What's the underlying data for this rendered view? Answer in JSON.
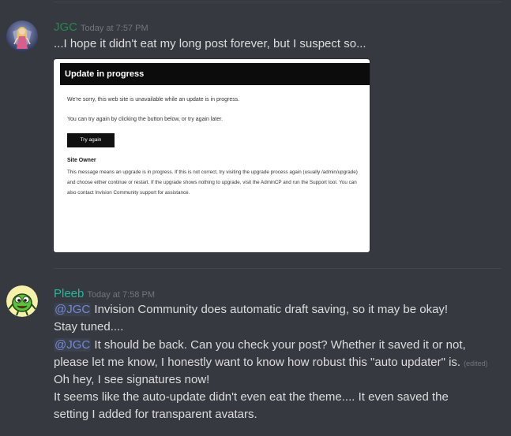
{
  "messages": [
    {
      "username": "JGC",
      "username_color": "#1f8b4c",
      "timestamp": "Today at 7:57 PM",
      "avatar_icon": "fairy-avatar-icon",
      "text": "...I hope it didn't eat my long post forever, but I suspect so...",
      "embed": {
        "title": "Update in progress",
        "line1": "We're sorry, this web site is unavailable while an update is in progress.",
        "line2": "You can try again by clicking the button below, or try again later.",
        "button_label": "Try again",
        "owner_title": "Site Owner",
        "owner_text": "This message means an upgrade is in progress. If this is not correct, try visiting the upgrade process again (usually /admin/upgrade) and choose either continue or restart. If the upgrade shows nothing to upgrade, visit the AdminCP and run the Support tool. You can also contact Invision Community support for assistance."
      }
    },
    {
      "username": "Pleeb",
      "username_color": "#1abc9c",
      "timestamp": "Today at 7:58 PM",
      "avatar_icon": "green-creature-avatar-icon",
      "lines": [
        {
          "mention": "@JGC",
          "text": " Invision Community does automatic draft saving, so it may be okay!"
        },
        {
          "text": "Stay tuned...."
        },
        {
          "mention": "@JGC",
          "text": " It should be back.  Can you check your post?  Whether it saved it or not,"
        },
        {
          "text": "please let me know, I honestly want to know how robust this \"auto updater\" is.",
          "edited": "(edited)"
        },
        {
          "text": "Oh hey, I see signatures now!"
        },
        {
          "text": "It seems like the auto-update didn't even eat the theme.... It even saved the"
        },
        {
          "text": "setting I added for transparent avatars."
        }
      ]
    }
  ]
}
